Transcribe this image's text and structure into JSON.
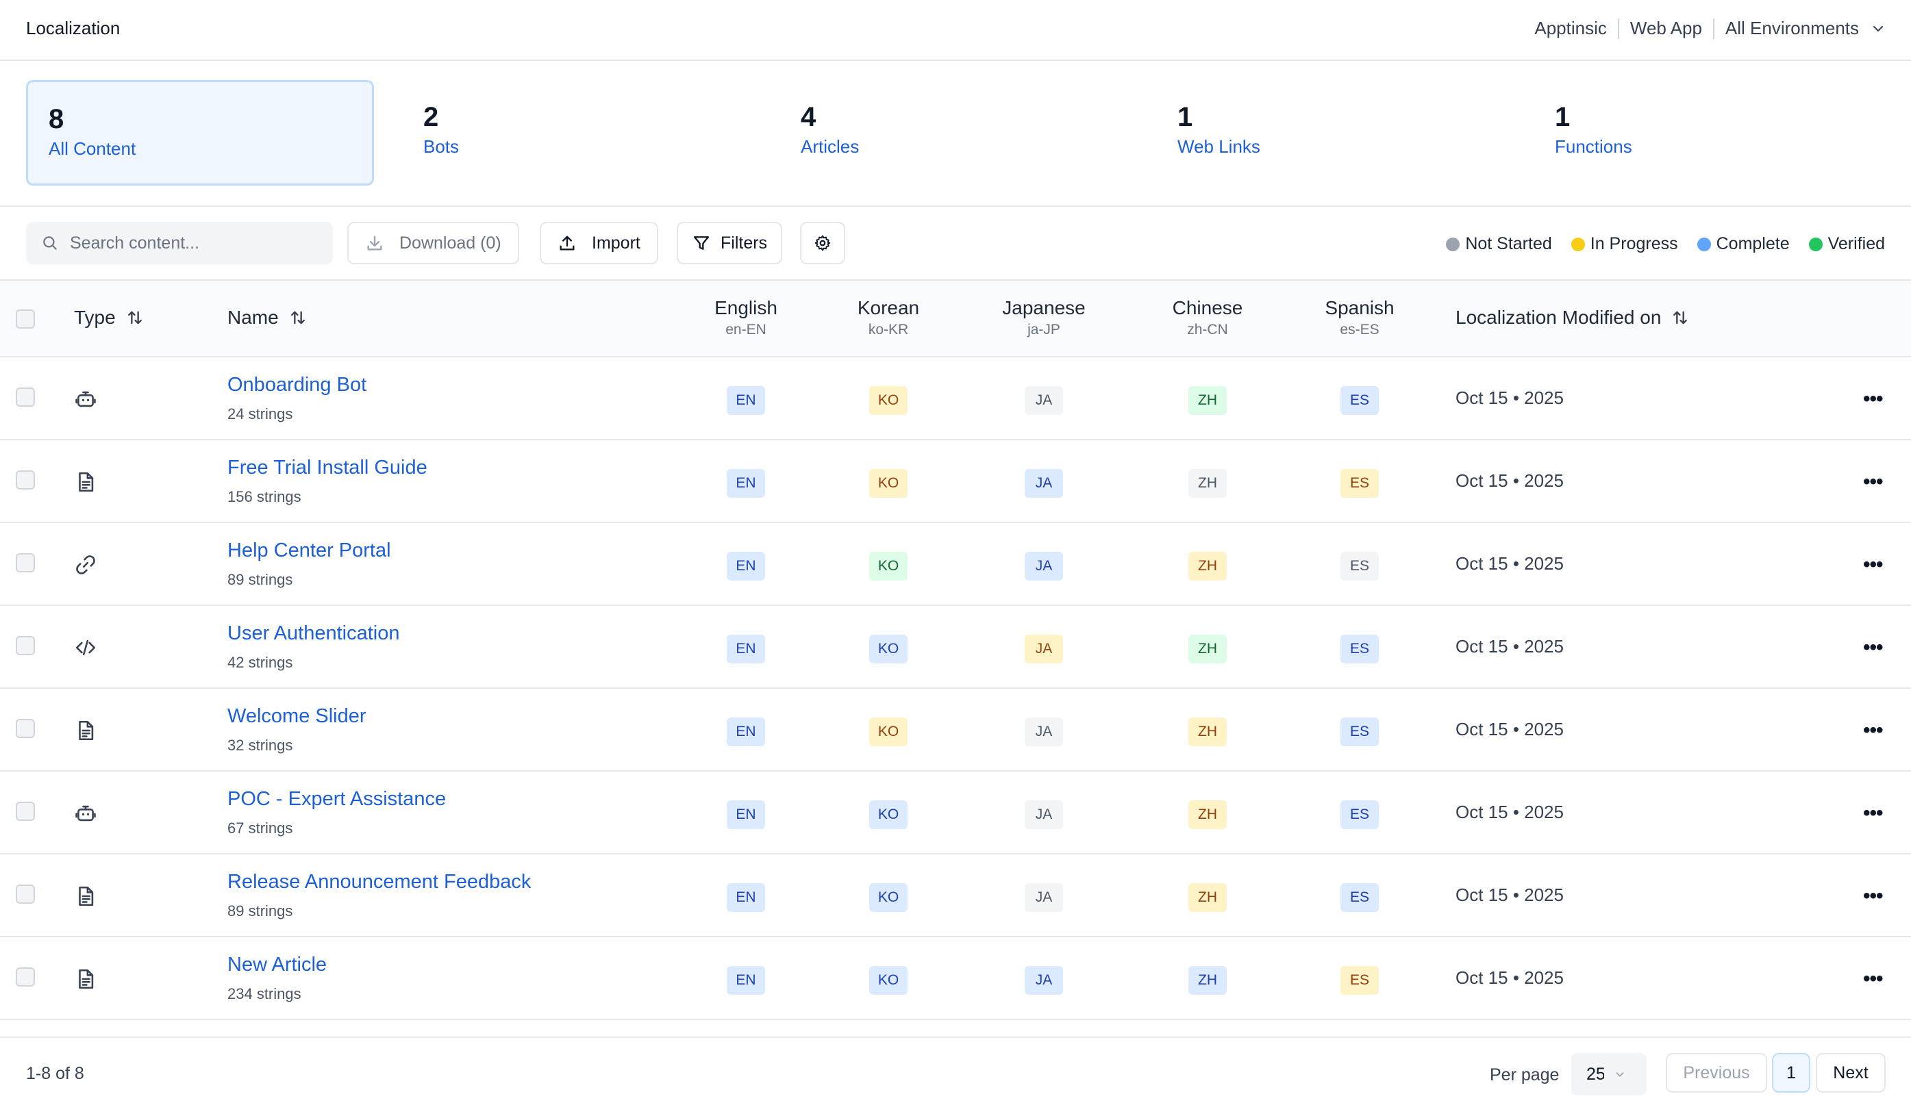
{
  "header": {
    "title": "Localization",
    "org": "Apptinsic",
    "app": "Web App",
    "environment": "All Environments"
  },
  "summary": [
    {
      "count": "8",
      "label": "All Content",
      "active": true
    },
    {
      "count": "2",
      "label": "Bots"
    },
    {
      "count": "4",
      "label": "Articles"
    },
    {
      "count": "1",
      "label": "Web Links"
    },
    {
      "count": "1",
      "label": "Functions"
    }
  ],
  "toolbar": {
    "search_placeholder": "Search content...",
    "download_label": "Download (0)",
    "import_label": "Import",
    "filters_label": "Filters"
  },
  "legend": [
    {
      "label": "Not Started",
      "color": "#9ca3af"
    },
    {
      "label": "In Progress",
      "color": "#facc15"
    },
    {
      "label": "Complete",
      "color": "#60a5fa"
    },
    {
      "label": "Verified",
      "color": "#22c55e"
    }
  ],
  "table": {
    "col_type": "Type",
    "col_name": "Name",
    "col_modified": "Localization Modified on",
    "languages": [
      {
        "name": "English",
        "code": "en-EN"
      },
      {
        "name": "Korean",
        "code": "ko-KR"
      },
      {
        "name": "Japanese",
        "code": "ja-JP"
      },
      {
        "name": "Chinese",
        "code": "zh-CN"
      },
      {
        "name": "Spanish",
        "code": "es-ES"
      }
    ],
    "badge_labels": [
      "EN",
      "KO",
      "JA",
      "ZH",
      "ES"
    ],
    "rows": [
      {
        "type": "bot",
        "name": "Onboarding Bot",
        "strings": "24 strings",
        "status": [
          "complete",
          "progress",
          "notstarted",
          "verified",
          "complete"
        ],
        "modified": "Oct 15 • 2025"
      },
      {
        "type": "article",
        "name": "Free Trial Install Guide",
        "strings": "156 strings",
        "status": [
          "complete",
          "progress",
          "complete",
          "notstarted",
          "progress"
        ],
        "modified": "Oct 15 • 2025"
      },
      {
        "type": "link",
        "name": "Help Center Portal",
        "strings": "89 strings",
        "status": [
          "complete",
          "verified",
          "complete",
          "progress",
          "notstarted"
        ],
        "modified": "Oct 15 • 2025"
      },
      {
        "type": "function",
        "name": "User Authentication",
        "strings": "42 strings",
        "status": [
          "complete",
          "complete",
          "progress",
          "verified",
          "complete"
        ],
        "modified": "Oct 15 • 2025"
      },
      {
        "type": "article",
        "name": "Welcome Slider",
        "strings": "32 strings",
        "status": [
          "complete",
          "progress",
          "notstarted",
          "progress",
          "complete"
        ],
        "modified": "Oct 15 • 2025"
      },
      {
        "type": "bot",
        "name": "POC - Expert Assistance",
        "strings": "67 strings",
        "status": [
          "complete",
          "complete",
          "notstarted",
          "progress",
          "complete"
        ],
        "modified": "Oct 15 • 2025"
      },
      {
        "type": "article",
        "name": "Release Announcement Feedback",
        "strings": "89 strings",
        "status": [
          "complete",
          "complete",
          "notstarted",
          "progress",
          "complete"
        ],
        "modified": "Oct 15 • 2025"
      },
      {
        "type": "article",
        "name": "New Article",
        "strings": "234 strings",
        "status": [
          "complete",
          "complete",
          "complete",
          "complete",
          "progress"
        ],
        "modified": "Oct 15 • 2025"
      }
    ]
  },
  "footer": {
    "range": "1-8 of 8",
    "per_page_label": "Per page",
    "per_page_value": "25",
    "previous_label": "Previous",
    "current_page": "1",
    "next_label": "Next"
  }
}
